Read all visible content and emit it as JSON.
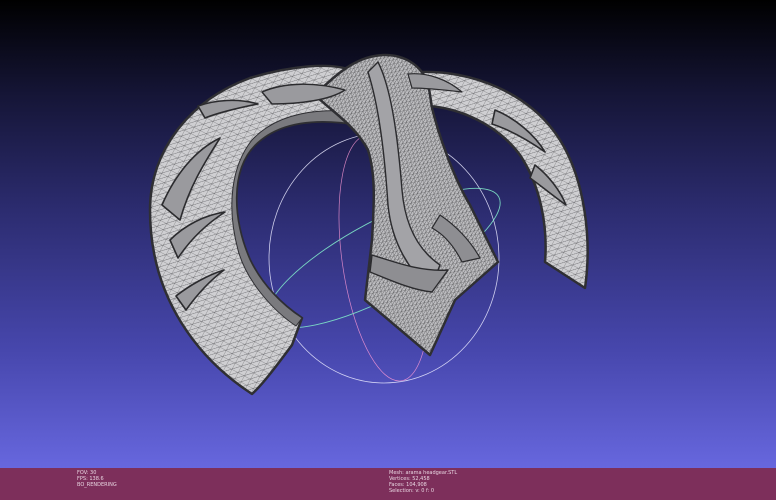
{
  "viewport": {
    "background_top": "#000000",
    "background_bottom": "#6767de",
    "mesh_fill": "#cfcfd2",
    "mesh_edge": "#3a3a3a",
    "trackball_color": "#e9e9ff",
    "trackball_green": "#7fe7c9"
  },
  "info_left": {
    "fov": "FOV: 30",
    "fps": "FPS:  138.6",
    "render_mode": "BO_RENDERING"
  },
  "info_right": {
    "mesh": "Mesh: arama headgear.STL",
    "vertices": "Vertices: 52,458",
    "faces": "Faces: 104,908",
    "selection": "Selection: v: 0 f: 0"
  },
  "status_bar_color": "#7d2f5b"
}
